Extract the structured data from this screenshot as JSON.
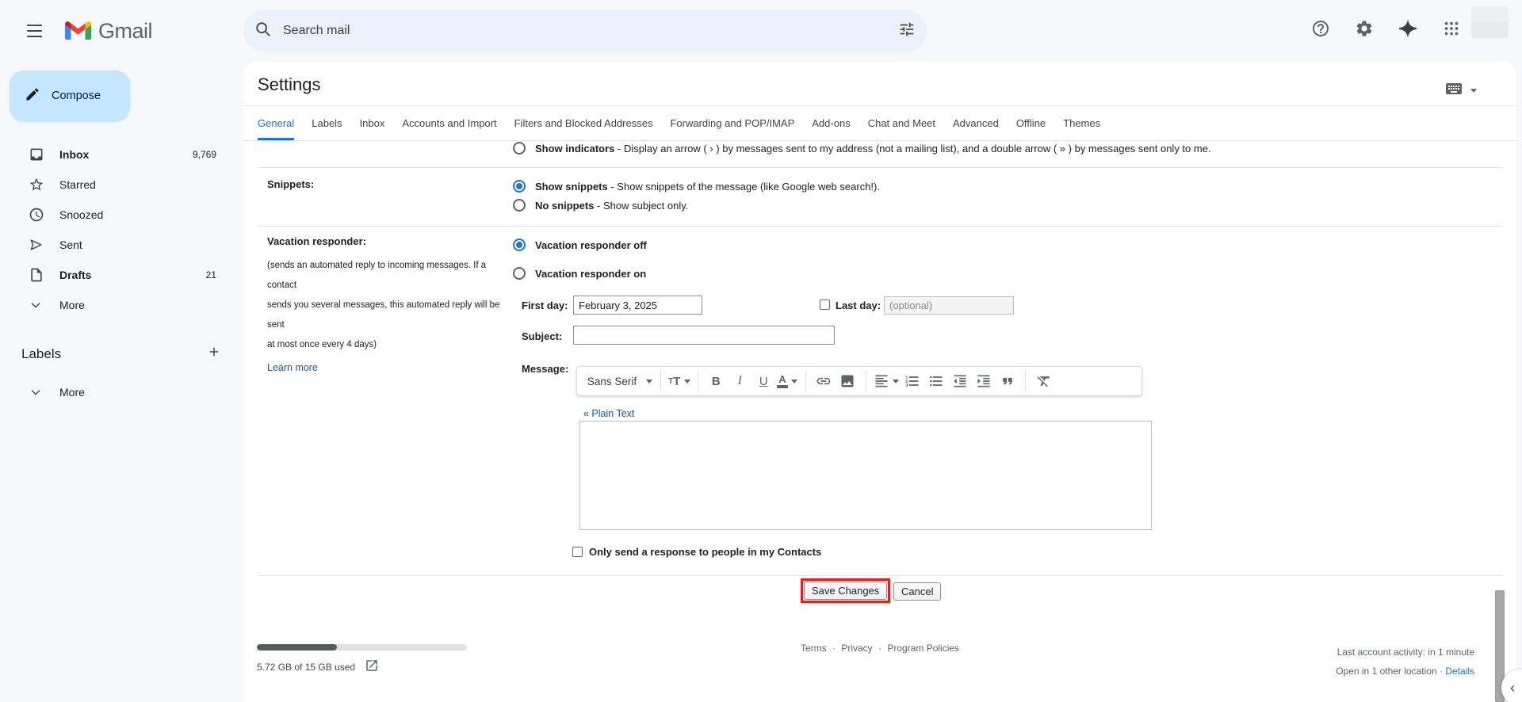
{
  "colors": {
    "accent_blue": "#1a73e8",
    "compose_button_bg": "#c2e7ff",
    "search_bg": "#eaf1fb",
    "header_bg": "#f6f8fc",
    "highlight_red": "#ed1c1c"
  },
  "header": {
    "brand": "Gmail",
    "search_placeholder": "Search mail"
  },
  "sidebar": {
    "compose_label": "Compose",
    "items": [
      {
        "label": "Inbox",
        "count": "9,769"
      },
      {
        "label": "Starred",
        "count": ""
      },
      {
        "label": "Snoozed",
        "count": ""
      },
      {
        "label": "Sent",
        "count": ""
      },
      {
        "label": "Drafts",
        "count": "21"
      },
      {
        "label": "More",
        "count": ""
      }
    ],
    "labels_heading": "Labels",
    "labels_more_label": "More"
  },
  "settings": {
    "title": "Settings",
    "active_tab": "General",
    "tabs": [
      "General",
      "Labels",
      "Inbox",
      "Accounts and Import",
      "Filters and Blocked Addresses",
      "Forwarding and POP/IMAP",
      "Add-ons",
      "Chat and Meet",
      "Advanced",
      "Offline",
      "Themes"
    ],
    "indicators_row": {
      "bold": "Show indicators",
      "text": "- Display an arrow ( › ) by messages sent to my address (not a mailing list), and a double arrow ( » ) by messages sent only to me."
    },
    "snippets_row": {
      "label": "Snippets:",
      "show_bold": "Show snippets",
      "show_text": "- Show snippets of the message (like Google web search!).",
      "no_bold": "No snippets",
      "no_text": "- Show subject only."
    },
    "vacation_row": {
      "label": "Vacation responder:",
      "desc_line1": "(sends an automated reply to incoming messages. If a contact",
      "desc_line2": "sends you several messages, this automated reply will be sent",
      "desc_line3": "at most once every 4 days)",
      "learn_more": "Learn more",
      "off_label": "Vacation responder off",
      "on_label": "Vacation responder on",
      "first_day_label": "First day:",
      "first_day_value": "February 3, 2025",
      "last_day_label": "Last day:",
      "last_day_placeholder": "(optional)",
      "subject_label": "Subject:",
      "message_label": "Message:",
      "toolbar_font": "Sans Serif",
      "plain_text_link": "« Plain Text",
      "contacts_label": "Only send a response to people in my Contacts"
    },
    "save_button": "Save Changes",
    "cancel_button": "Cancel"
  },
  "footer": {
    "storage_used": "5.72 GB of 15 GB used",
    "storage_percent": 38,
    "terms": "Terms",
    "privacy": "Privacy",
    "policies": "Program Policies",
    "separator": "·",
    "activity": "Last account activity: in 1 minute",
    "open_location": "Open in 1 other location",
    "details_link": "Details"
  }
}
